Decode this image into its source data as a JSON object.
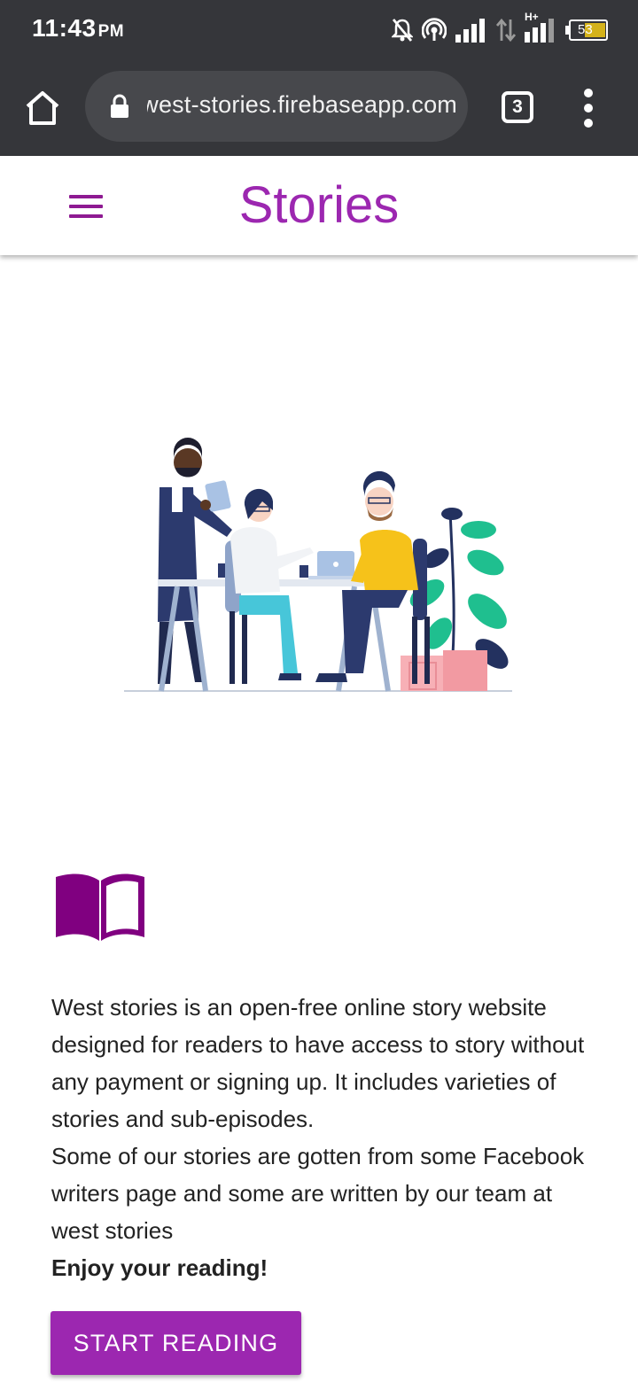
{
  "status_bar": {
    "time": "11:43",
    "ampm": "PM",
    "battery": "53",
    "network_type": "H+",
    "icons": [
      "mute-icon",
      "hotspot-icon",
      "signal-icon",
      "data-arrows-icon",
      "signal-icon",
      "battery-icon"
    ]
  },
  "browser": {
    "url": "west-stories.firebaseapp.com",
    "tab_count": "3",
    "icons": [
      "home-icon",
      "lock-icon",
      "more-vert-icon"
    ]
  },
  "app": {
    "title": "Stories",
    "menu_icon": "hamburger-icon",
    "illustration": "team-meeting-illustration",
    "book_icon": "open-book-icon"
  },
  "content": {
    "paragraph1": "West stories is an open-free online story website designed for readers to have access to story without any payment or signing up. It includes varieties of stories and sub-episodes.",
    "paragraph2": "Some of our stories are gotten from some Facebook writers page and some are written by our team at west stories",
    "closing": "Enjoy your reading!",
    "button_label": "START READING"
  },
  "colors": {
    "accent": "#9c27b0",
    "book": "#800080",
    "browser_chrome": "#35363a",
    "url_field": "#47484c"
  }
}
